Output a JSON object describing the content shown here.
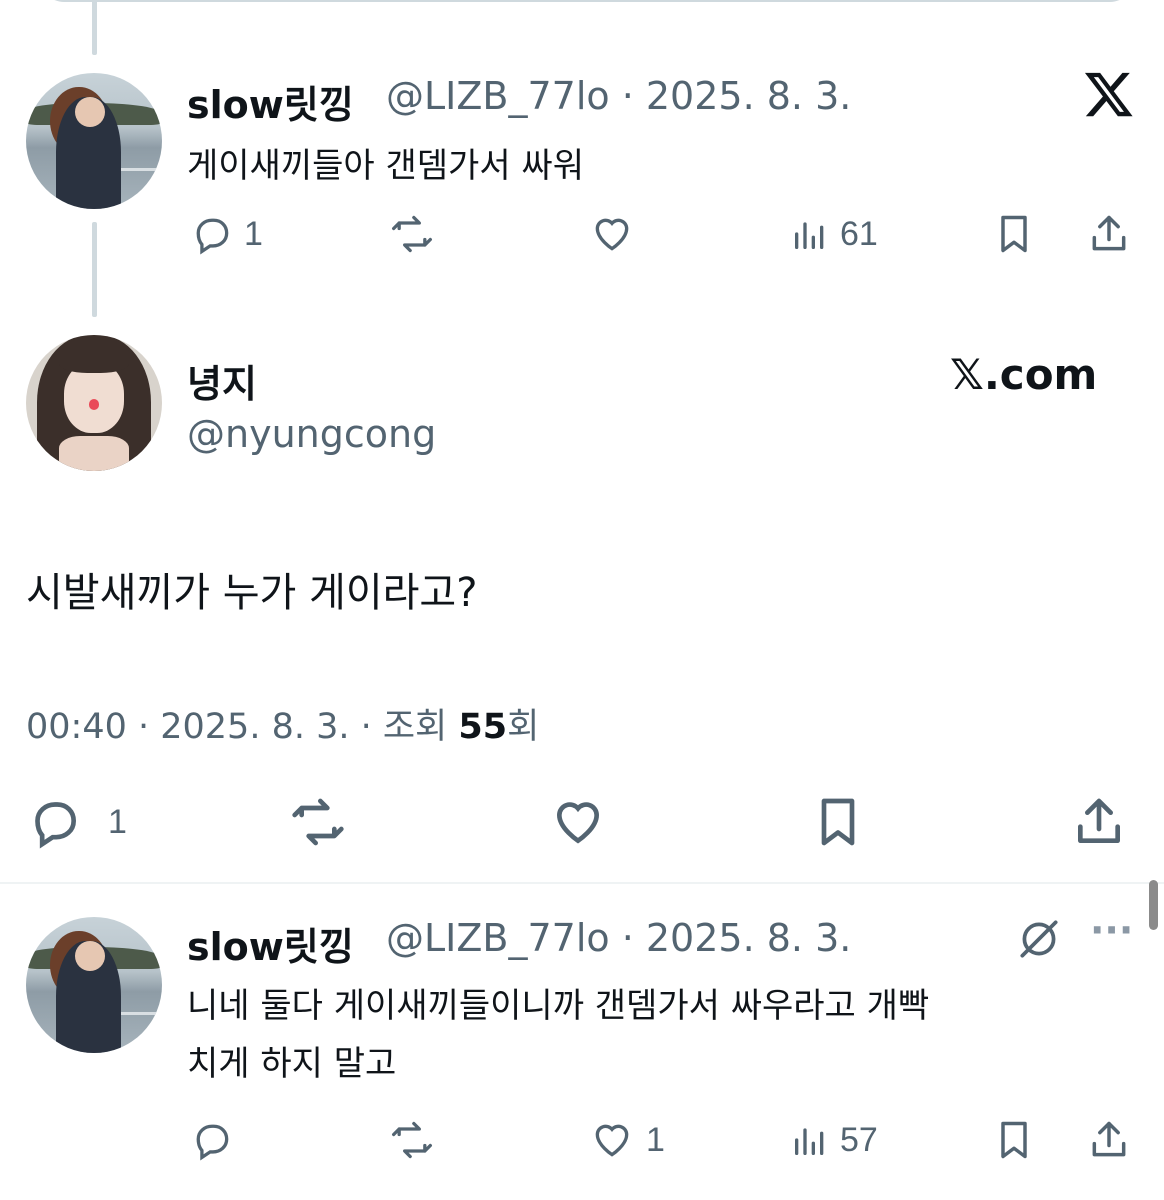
{
  "reply1": {
    "display_name": "slow릿낑",
    "handle_date": "@LIZB_77lo · 2025. 8. 3.",
    "text": "게이새끼들아 갠뎀가서 싸워",
    "replies": "1",
    "views": "61",
    "icon": "x-logo-icon"
  },
  "main": {
    "display_name": "녕지",
    "handle": "@nyungcong",
    "brand": "𝕏.com",
    "text": "시발새끼가 누가 게이라고?",
    "time_date": "00:40 · 2025. 8. 3. · 조회 ",
    "views": "55",
    "views_suffix": "회",
    "replies": "1"
  },
  "reply2": {
    "display_name": "slow릿낑",
    "handle_date": "@LIZB_77lo · 2025. 8. 3.",
    "text_line1": "니네 둘다 게이새끼들이니까 갠뎀가서 싸우라고 개빡",
    "text_line2": "치게 하지 말고",
    "likes": "1",
    "views": "57",
    "icon": "grok-icon",
    "more": "···"
  },
  "colors": {
    "text": "#0f1419",
    "muted": "#536471",
    "border": "#cfd9de"
  }
}
